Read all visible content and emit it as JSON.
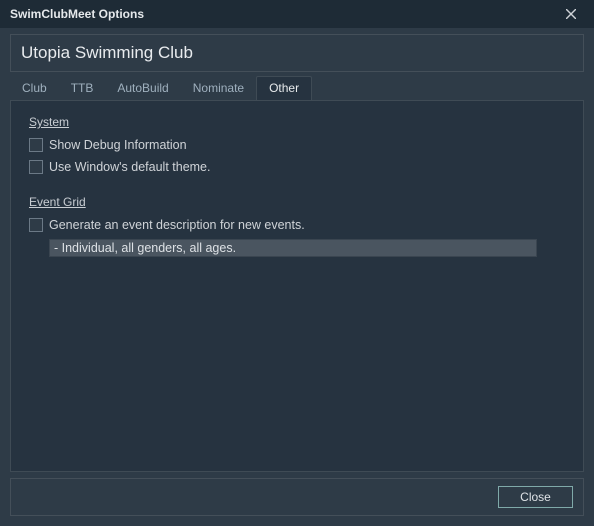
{
  "window": {
    "title": "SwimClubMeet Options"
  },
  "header": {
    "club_name": "Utopia Swimming Club"
  },
  "tabs": {
    "items": [
      {
        "label": "Club"
      },
      {
        "label": "TTB"
      },
      {
        "label": "AutoBuild"
      },
      {
        "label": "Nominate"
      },
      {
        "label": "Other"
      }
    ],
    "active_index": 4
  },
  "sections": {
    "system": {
      "title": "System",
      "show_debug": {
        "label": "Show Debug Information",
        "checked": false
      },
      "default_theme": {
        "label": "Use Window's default theme.",
        "checked": false
      }
    },
    "event_grid": {
      "title": "Event Grid",
      "generate_desc": {
        "label": "Generate an event description for new events.",
        "checked": false
      },
      "desc_value": "- Individual, all genders, all ages."
    }
  },
  "footer": {
    "close_label": "Close"
  }
}
